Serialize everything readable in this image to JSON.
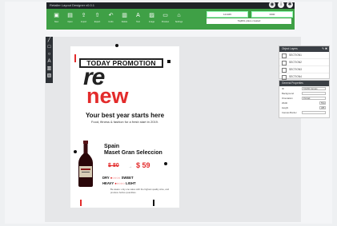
{
  "app": {
    "title": "Retailer Layout Designer v0.0.1"
  },
  "window_icons": [
    {
      "name": "globe-icon",
      "glyph": "◉"
    },
    {
      "name": "info-icon",
      "glyph": "i"
    },
    {
      "name": "settings-icon",
      "glyph": "✱"
    }
  ],
  "toolbar": {
    "tools": [
      {
        "id": "new",
        "label": "New",
        "icon": "file-icon",
        "glyph": "▣"
      },
      {
        "id": "open",
        "label": "Open",
        "icon": "folder-icon",
        "glyph": "▤"
      },
      {
        "id": "import",
        "label": "Import",
        "icon": "import-icon",
        "glyph": "⇪"
      },
      {
        "id": "export",
        "label": "Export",
        "icon": "export-icon",
        "glyph": "⇧"
      },
      {
        "id": "undo",
        "label": "Undo",
        "icon": "undo-icon",
        "glyph": "↶"
      },
      {
        "id": "delete",
        "label": "Delete",
        "icon": "trash-icon",
        "glyph": "▥"
      },
      {
        "id": "text",
        "label": "Text",
        "icon": "text-icon",
        "glyph": "A"
      },
      {
        "id": "image",
        "label": "Image",
        "icon": "image-icon",
        "glyph": "▨"
      },
      {
        "id": "preview",
        "label": "Preview",
        "icon": "monitor-icon",
        "glyph": "▭"
      },
      {
        "id": "settings",
        "label": "Settings",
        "icon": "settings-icon",
        "glyph": "⌂"
      }
    ],
    "field1_value": "121345",
    "field2_value": "0000",
    "save_label": "Tag50L place created"
  },
  "palette": [
    {
      "name": "line-tool-icon",
      "glyph": "╱"
    },
    {
      "name": "rectangle-tool-icon",
      "glyph": "□"
    },
    {
      "name": "circle-tool-icon",
      "glyph": "○"
    },
    {
      "name": "text-tool-icon",
      "glyph": "A"
    },
    {
      "name": "barcode-tool-icon",
      "glyph": "▥"
    },
    {
      "name": "image-tool-icon",
      "glyph": "▨"
    }
  ],
  "flyer": {
    "promo": "TODAY PROMOTION",
    "re": "re",
    "new": "new",
    "headline": "Your best year starts here",
    "subline": "Food, fitness & fashion for a fresh start in 2019.",
    "product_name_1": "Spain",
    "product_name_2": "Maset Gran Seleccion",
    "old_price": "$ 80",
    "arrow": "→",
    "new_price": "$ 59",
    "taste": [
      {
        "left": "DRY",
        "dots": "●○○○○",
        "right": "SWEET"
      },
      {
        "left": "HEAVY",
        "dots": "●○○○○",
        "right": "LIGHT"
      }
    ],
    "fine_print": "Be aware: only one sales with the highest quality wine, and produce before quantities."
  },
  "layers_panel": {
    "title": "Object Layers",
    "head_icons": "✎ ✖",
    "items": [
      "SECTION1",
      "SECTION2",
      "SECTION3",
      "SECTION4"
    ]
  },
  "props_panel": {
    "title": "General Properties",
    "rows": [
      {
        "label": "ID",
        "value": "TAG50 Canvas"
      },
      {
        "label": "Background",
        "value": ""
      },
      {
        "label": "Orientation",
        "value": "Portrait"
      },
      {
        "label": "Width",
        "value": "55m"
      },
      {
        "label": "Height",
        "value": "385"
      },
      {
        "label": "Canvas Border",
        "value": ""
      }
    ]
  },
  "colors": {
    "accent_green": "#3fa046",
    "promo_red": "#e32b2b",
    "dark": "#2c3036"
  }
}
